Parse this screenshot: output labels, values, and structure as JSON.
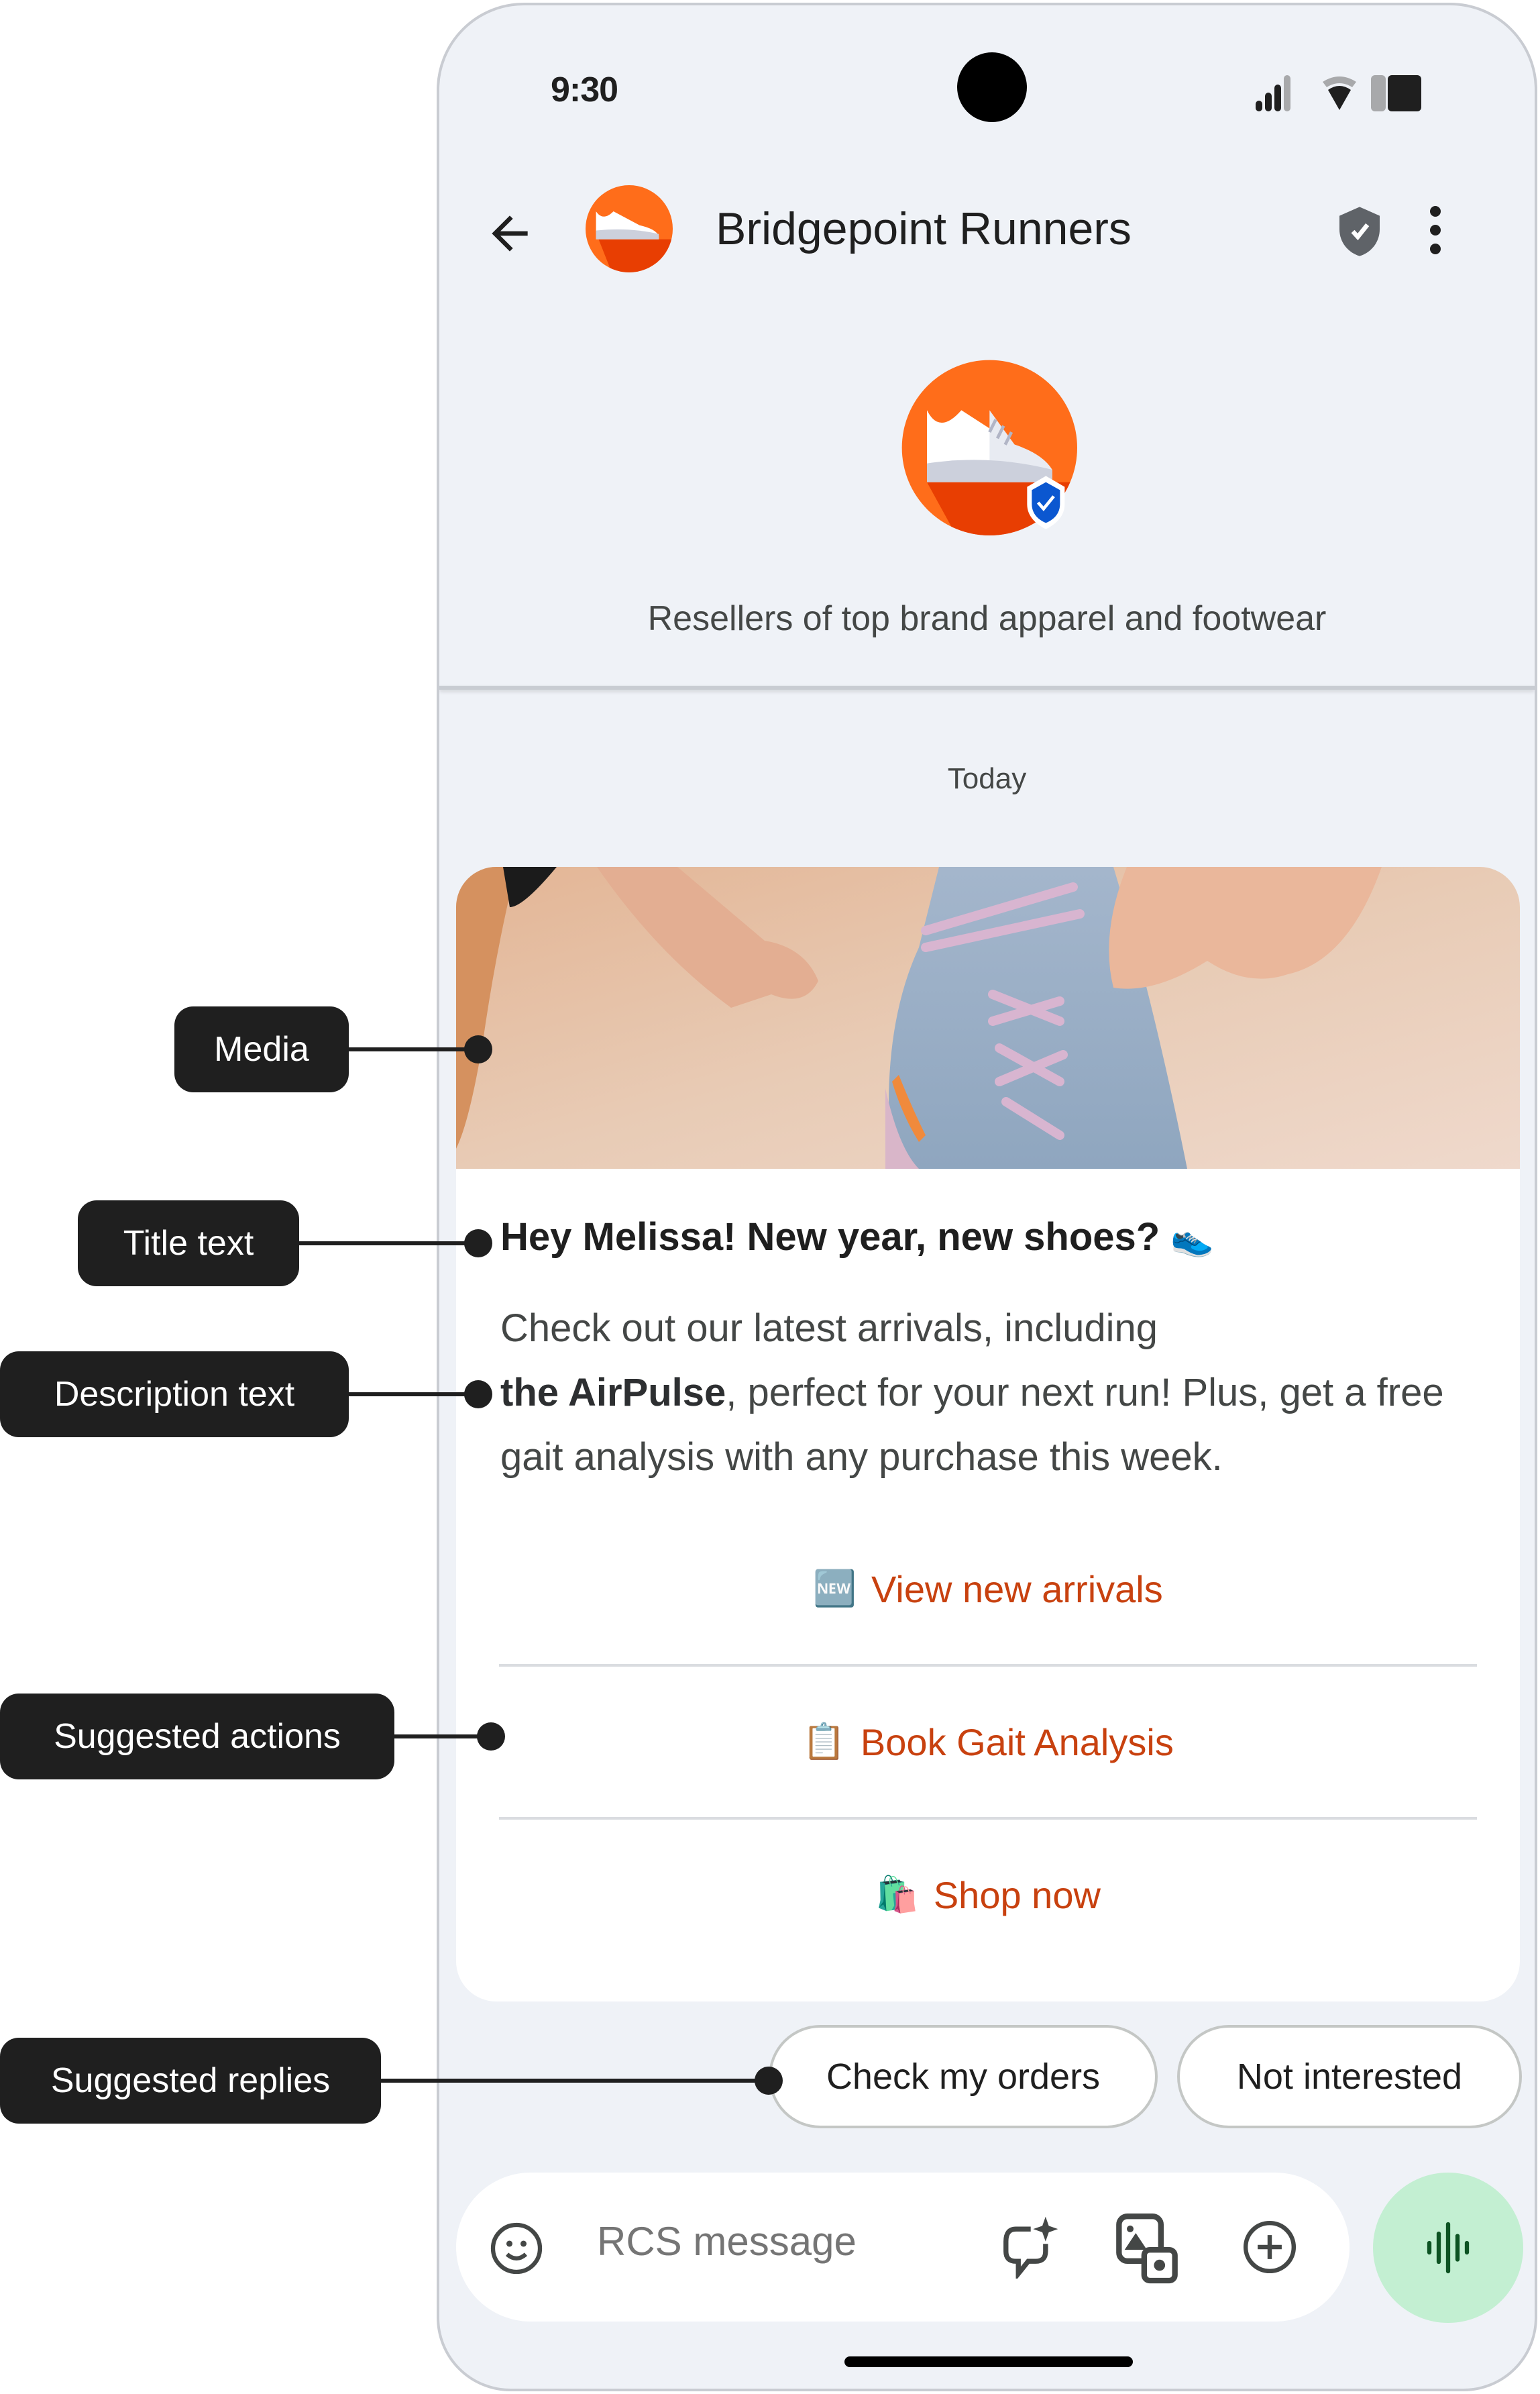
{
  "status_bar": {
    "time": "9:30"
  },
  "header": {
    "business_name": "Bridgepoint Runners",
    "back_icon": "arrow-back-icon",
    "verified_icon": "verified-shield-icon",
    "menu_icon": "more-vert-icon"
  },
  "profile": {
    "description": "Resellers of top brand apparel and footwear",
    "verified_badge": "verified-check-icon"
  },
  "conversation": {
    "date_label": "Today",
    "rich_card": {
      "media_alt": "Person tying laces of a blue running shoe",
      "title": "Hey Melissa! New year, new shoes?",
      "title_emoji": "👟",
      "description_line1": "Check out our latest arrivals, including",
      "description_bold": "the AirPulse",
      "description_rest": ", perfect for your next run! Plus, get a free gait analysis with any purchase this week.",
      "suggested_actions": [
        {
          "emoji": "🆕",
          "label": "View new arrivals"
        },
        {
          "emoji": "📋",
          "label": "Book Gait Analysis"
        },
        {
          "emoji": "🛍️",
          "label": "Shop now"
        }
      ]
    },
    "suggested_replies": [
      {
        "label": "Check my orders"
      },
      {
        "label": "Not interested"
      }
    ]
  },
  "compose": {
    "placeholder": "RCS message",
    "icons": [
      "emoji-icon",
      "magic-compose-icon",
      "gallery-camera-icon",
      "add-circle-icon",
      "voice-message-icon"
    ]
  },
  "annotations": [
    {
      "label": "Media"
    },
    {
      "label": "Title text"
    },
    {
      "label": "Description text"
    },
    {
      "label": "Suggested actions"
    },
    {
      "label": "Suggested replies"
    }
  ],
  "colors": {
    "accent": "#c8410f",
    "brand_orange": "#ff6d1a",
    "brand_orange_dark": "#e83e02",
    "verified_blue": "#0b57d0",
    "mic_bg": "#c3efd2",
    "mic_fg": "#0d5323",
    "background": "#eff2f7"
  }
}
